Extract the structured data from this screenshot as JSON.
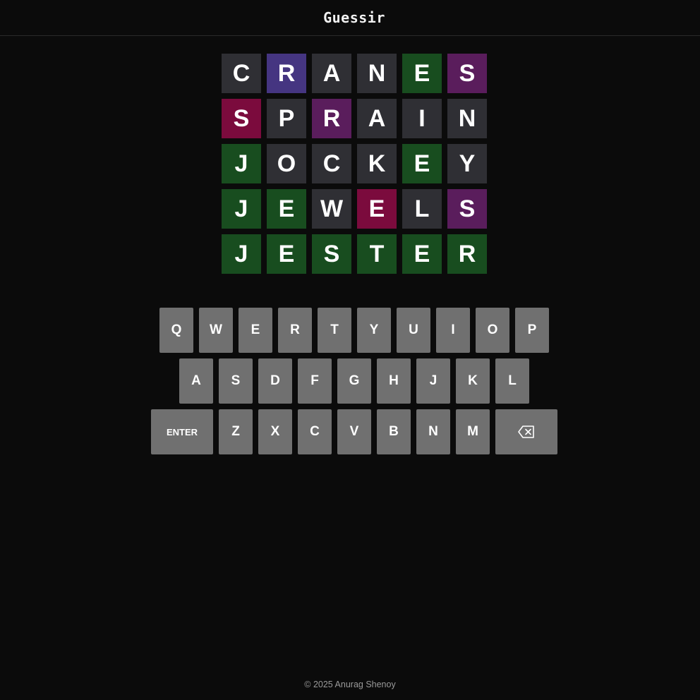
{
  "header": {
    "title": "Guessir"
  },
  "colors": {
    "background": "#0b0b0b",
    "absent": "#2f2f34",
    "correct": "#184d1f",
    "blue": "#453581",
    "violet": "#5a1d5c",
    "magenta": "#7b0b3d",
    "key": "#707070"
  },
  "board": {
    "rows": [
      [
        {
          "letter": "C",
          "state": "absent"
        },
        {
          "letter": "R",
          "state": "blue"
        },
        {
          "letter": "A",
          "state": "absent"
        },
        {
          "letter": "N",
          "state": "absent"
        },
        {
          "letter": "E",
          "state": "correct"
        },
        {
          "letter": "S",
          "state": "violet"
        }
      ],
      [
        {
          "letter": "S",
          "state": "magenta"
        },
        {
          "letter": "P",
          "state": "absent"
        },
        {
          "letter": "R",
          "state": "violet"
        },
        {
          "letter": "A",
          "state": "absent"
        },
        {
          "letter": "I",
          "state": "absent"
        },
        {
          "letter": "N",
          "state": "absent"
        }
      ],
      [
        {
          "letter": "J",
          "state": "correct"
        },
        {
          "letter": "O",
          "state": "absent"
        },
        {
          "letter": "C",
          "state": "absent"
        },
        {
          "letter": "K",
          "state": "absent"
        },
        {
          "letter": "E",
          "state": "correct"
        },
        {
          "letter": "Y",
          "state": "absent"
        }
      ],
      [
        {
          "letter": "J",
          "state": "correct"
        },
        {
          "letter": "E",
          "state": "correct"
        },
        {
          "letter": "W",
          "state": "absent"
        },
        {
          "letter": "E",
          "state": "magenta"
        },
        {
          "letter": "L",
          "state": "absent"
        },
        {
          "letter": "S",
          "state": "violet"
        }
      ],
      [
        {
          "letter": "J",
          "state": "correct"
        },
        {
          "letter": "E",
          "state": "correct"
        },
        {
          "letter": "S",
          "state": "correct"
        },
        {
          "letter": "T",
          "state": "correct"
        },
        {
          "letter": "E",
          "state": "correct"
        },
        {
          "letter": "R",
          "state": "correct"
        }
      ]
    ]
  },
  "keyboard": {
    "rows": [
      [
        "Q",
        "W",
        "E",
        "R",
        "T",
        "Y",
        "U",
        "I",
        "O",
        "P"
      ],
      [
        "A",
        "S",
        "D",
        "F",
        "G",
        "H",
        "J",
        "K",
        "L"
      ],
      [
        "ENTER",
        "Z",
        "X",
        "C",
        "V",
        "B",
        "N",
        "M",
        "⌫"
      ]
    ],
    "backspace_icon": "backspace-icon"
  },
  "footer": {
    "text": "© 2025 Anurag Shenoy"
  }
}
